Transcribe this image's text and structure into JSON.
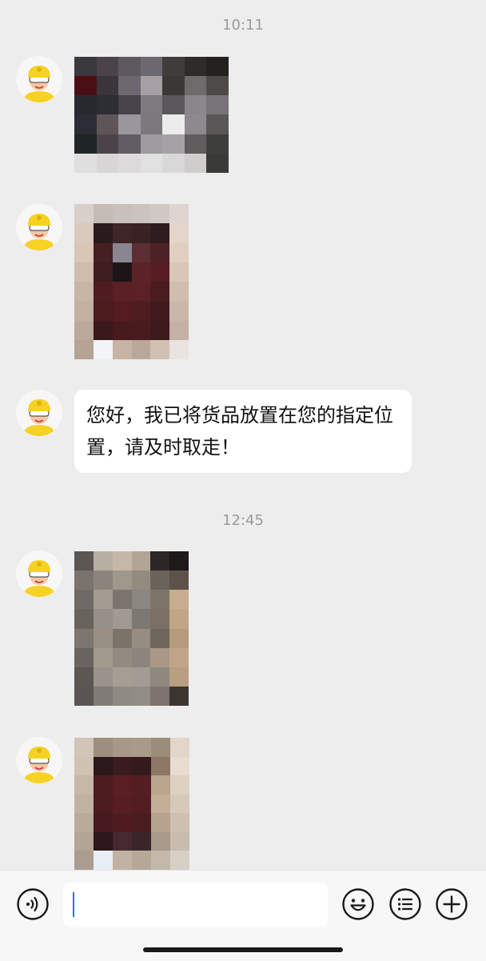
{
  "chat": {
    "timestamps": [
      "10:11",
      "12:45"
    ],
    "messages": [
      {
        "type": "image",
        "content": "blurred-photo"
      },
      {
        "type": "image",
        "content": "blurred-photo"
      },
      {
        "type": "text",
        "text": "您好，我已将货品放置在您的指定位置，请及时取走！"
      },
      {
        "type": "image",
        "content": "blurred-photo"
      },
      {
        "type": "image",
        "content": "blurred-photo"
      }
    ]
  },
  "input_bar": {
    "value": "",
    "placeholder": "",
    "icons": [
      "voice-icon",
      "emoji-icon",
      "quick-reply-icon",
      "plus-icon"
    ]
  },
  "colors": {
    "background": "#ededed",
    "bubble": "#ffffff",
    "avatar_helmet": "#f5d224",
    "caret": "#2f6dff"
  }
}
